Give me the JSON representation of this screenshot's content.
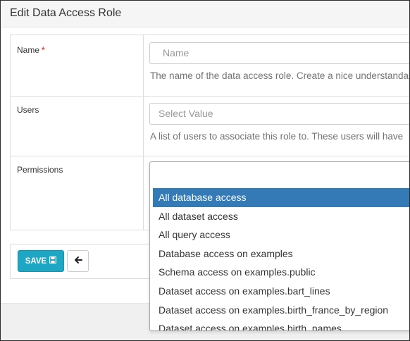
{
  "panel": {
    "title": "Edit Data Access Role"
  },
  "form": {
    "name": {
      "label": "Name",
      "required_mark": "*",
      "placeholder": "Name",
      "help": "The name of the data access role. Create a nice understandable"
    },
    "users": {
      "label": "Users",
      "placeholder": "Select Value",
      "help": "A list of users to associate this role to. These users will have"
    },
    "permissions": {
      "label": "Permissions",
      "search_value": ""
    }
  },
  "buttons": {
    "save_label": "SAVE",
    "save_icon": "floppy-disk-icon",
    "back_icon": "arrow-left-icon"
  },
  "dropdown": {
    "options": [
      "All database access",
      "All dataset access",
      "All query access",
      "Database access on examples",
      "Schema access on examples.public",
      "Dataset access on examples.bart_lines",
      "Dataset access on examples.birth_france_by_region",
      "Dataset access on examples.birth_names"
    ],
    "highlighted_index": 0
  },
  "colors": {
    "save_button": "#1ea7c5",
    "highlight": "#337ab7",
    "required": "#d9534f"
  }
}
